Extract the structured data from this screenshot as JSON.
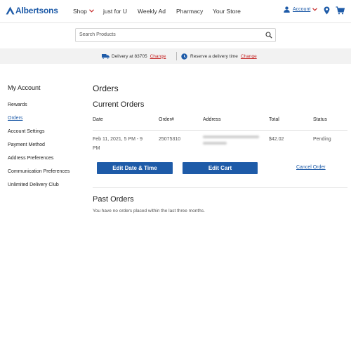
{
  "brand": {
    "name": "Albertsons",
    "color": "#1e5ba8",
    "accent": "#c62828"
  },
  "nav": {
    "shop": "Shop",
    "just_for_u": "just for U",
    "weekly_ad": "Weekly Ad",
    "pharmacy": "Pharmacy",
    "your_store": "Your Store",
    "account": "Account"
  },
  "search": {
    "placeholder": "Search Products"
  },
  "delivery": {
    "delivery_text": "Delivery at 83705",
    "change_1": "Change",
    "reserve_text": "Reserve a delivery time",
    "change_2": "Change"
  },
  "sidebar": {
    "title": "My Account",
    "items": [
      {
        "label": "Rewards"
      },
      {
        "label": "Orders",
        "active": true
      },
      {
        "label": "Account Settings"
      },
      {
        "label": "Payment Method"
      },
      {
        "label": "Address Preferences"
      },
      {
        "label": "Communication Preferences"
      },
      {
        "label": "Unlimited Delivery Club"
      }
    ]
  },
  "main": {
    "title": "Orders",
    "current_heading": "Current Orders",
    "columns": [
      "Date",
      "Order#",
      "Address",
      "Total",
      "Status"
    ],
    "order": {
      "date_line1": "Feb 11, 2021, 5 PM - 9",
      "date_line2": "PM",
      "order_number": "25075310",
      "total": "$42.02",
      "status": "Pending"
    },
    "edit_date_btn": "Edit Date & Time",
    "edit_cart_btn": "Edit Cart",
    "cancel_link": "Cancel Order",
    "past_heading": "Past Orders",
    "past_message": "You have no orders placed within the last three months."
  }
}
